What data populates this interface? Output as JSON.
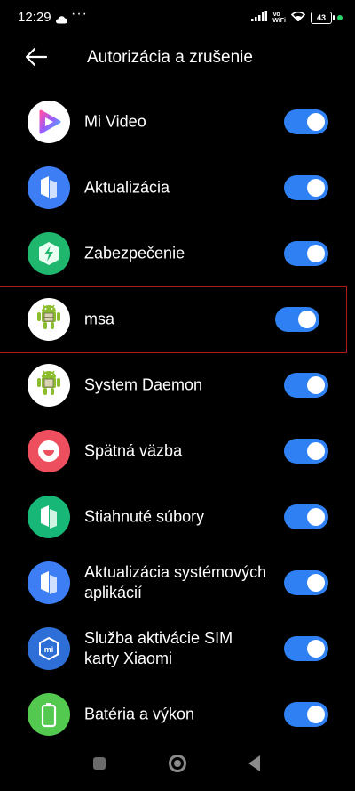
{
  "status": {
    "time": "12:29",
    "icons": [
      "cloud-icon",
      "more-dots-icon",
      "signal-icon",
      "vowifi-icon",
      "wifi-icon",
      "battery-icon"
    ],
    "vowifi_top": "Vo",
    "vowifi_bottom": "WiFi",
    "battery": "43",
    "dots": "···"
  },
  "header": {
    "title": "Autorizácia a zrušenie",
    "back_icon": "arrow-left-icon"
  },
  "apps": [
    {
      "label": "Mi Video",
      "icon": "mi-video-icon",
      "enabled": true
    },
    {
      "label": "Aktualizácia",
      "icon": "update-icon",
      "enabled": true
    },
    {
      "label": "Zabezpečenie",
      "icon": "security-icon",
      "enabled": true
    },
    {
      "label": "msa",
      "icon": "android-icon",
      "enabled": true
    },
    {
      "label": "System Daemon",
      "icon": "android-icon",
      "enabled": true
    },
    {
      "label": "Spätná väzba",
      "icon": "feedback-icon",
      "enabled": true
    },
    {
      "label": "Stiahnuté súbory",
      "icon": "downloads-icon",
      "enabled": true
    },
    {
      "label": "Aktualizácia systémových aplikácií",
      "icon": "update-icon",
      "enabled": true
    },
    {
      "label": "Služba aktivácie SIM karty Xiaomi",
      "icon": "sim-activation-icon",
      "enabled": true
    },
    {
      "label": "Batéria a výkon",
      "icon": "battery-performance-icon",
      "enabled": true
    }
  ],
  "colors": {
    "toggle_on": "#2f80f2",
    "highlight_border": "#b01a1a"
  },
  "navbar": {
    "icons": [
      "recents-icon",
      "home-icon",
      "back-icon"
    ]
  }
}
